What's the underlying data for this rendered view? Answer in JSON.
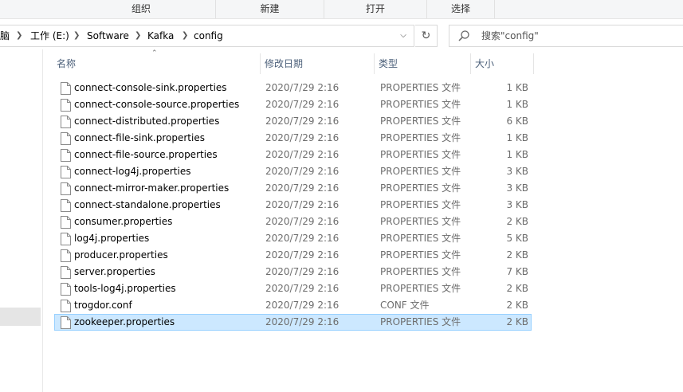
{
  "ribbon": {
    "groups": [
      "组织",
      "新建",
      "打开",
      "选择"
    ]
  },
  "address": {
    "crumbs": [
      "脑",
      "工作 (E:)",
      "Software",
      "Kafka",
      "config"
    ]
  },
  "search": {
    "placeholder": "搜索\"config\""
  },
  "columns": {
    "name": "名称",
    "date": "修改日期",
    "type": "类型",
    "size": "大小"
  },
  "files": [
    {
      "name": "connect-console-sink.properties",
      "date": "2020/7/29 2:16",
      "type": "PROPERTIES 文件",
      "size": "1 KB"
    },
    {
      "name": "connect-console-source.properties",
      "date": "2020/7/29 2:16",
      "type": "PROPERTIES 文件",
      "size": "1 KB"
    },
    {
      "name": "connect-distributed.properties",
      "date": "2020/7/29 2:16",
      "type": "PROPERTIES 文件",
      "size": "6 KB"
    },
    {
      "name": "connect-file-sink.properties",
      "date": "2020/7/29 2:16",
      "type": "PROPERTIES 文件",
      "size": "1 KB"
    },
    {
      "name": "connect-file-source.properties",
      "date": "2020/7/29 2:16",
      "type": "PROPERTIES 文件",
      "size": "1 KB"
    },
    {
      "name": "connect-log4j.properties",
      "date": "2020/7/29 2:16",
      "type": "PROPERTIES 文件",
      "size": "3 KB"
    },
    {
      "name": "connect-mirror-maker.properties",
      "date": "2020/7/29 2:16",
      "type": "PROPERTIES 文件",
      "size": "3 KB"
    },
    {
      "name": "connect-standalone.properties",
      "date": "2020/7/29 2:16",
      "type": "PROPERTIES 文件",
      "size": "3 KB"
    },
    {
      "name": "consumer.properties",
      "date": "2020/7/29 2:16",
      "type": "PROPERTIES 文件",
      "size": "2 KB"
    },
    {
      "name": "log4j.properties",
      "date": "2020/7/29 2:16",
      "type": "PROPERTIES 文件",
      "size": "5 KB"
    },
    {
      "name": "producer.properties",
      "date": "2020/7/29 2:16",
      "type": "PROPERTIES 文件",
      "size": "2 KB"
    },
    {
      "name": "server.properties",
      "date": "2020/7/29 2:16",
      "type": "PROPERTIES 文件",
      "size": "7 KB"
    },
    {
      "name": "tools-log4j.properties",
      "date": "2020/7/29 2:16",
      "type": "PROPERTIES 文件",
      "size": "2 KB"
    },
    {
      "name": "trogdor.conf",
      "date": "2020/7/29 2:16",
      "type": "CONF 文件",
      "size": "2 KB"
    },
    {
      "name": "zookeeper.properties",
      "date": "2020/7/29 2:16",
      "type": "PROPERTIES 文件",
      "size": "2 KB"
    }
  ],
  "selected_index": 14,
  "colors": {
    "selection_bg": "#cce8ff",
    "selection_border": "#99d1ff",
    "header_text": "#4c607a",
    "meta_text": "#6d6d6d"
  }
}
